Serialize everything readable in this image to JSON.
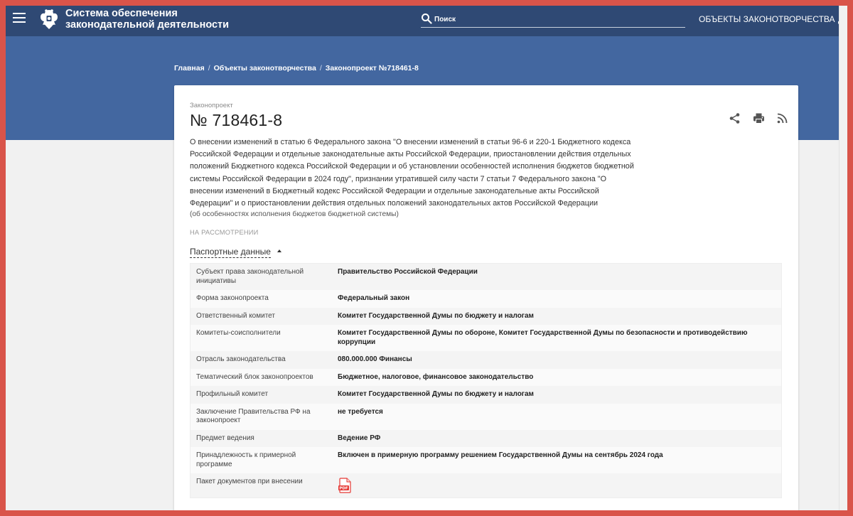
{
  "header": {
    "site_title_line1": "Система обеспечения",
    "site_title_line2": "законодательной деятельности",
    "search_placeholder": "Поиск",
    "nav_items": [
      "ОБЪЕКТЫ ЗАКОНОТВОРЧЕСТВА",
      "ДО"
    ]
  },
  "breadcrumb": {
    "items": [
      "Главная",
      "Объекты законотворчества",
      "Законопроект №718461-8"
    ]
  },
  "bill": {
    "kind": "Законопроект",
    "number": "№ 718461-8",
    "description_lines": [
      "О внесении изменений в статью 6 Федерального закона \"О внесении изменений в статьи 96-6 и 220-1 Бюджетного кодекса",
      "Российской Федерации и отдельные законодательные акты Российской Федерации, приостановлении действия отдельных",
      "положений Бюджетного кодекса Российской Федерации и об установлении особенностей исполнения бюджетов бюджетной",
      "системы Российской Федерации в 2024 году\", признании утратившей силу части 7 статьи 7 Федерального закона \"О",
      "внесении изменений в Бюджетный кодекс Российской Федерации и отдельные законодательные акты Российской",
      "Федерации\" и о приостановлении действия отдельных положений законодательных актов Российской Федерации"
    ],
    "subnote": "(об особенностях исполнения бюджетов бюджетной системы)",
    "status": "НА РАССМОТРЕНИИ",
    "actions": [
      "share-icon",
      "print-icon",
      "rss-icon"
    ]
  },
  "passport": {
    "toggle_label": "Паспортные данные",
    "rows": [
      {
        "label": "Субъект права законодательной инициативы",
        "value": "Правительство Российской Федерации"
      },
      {
        "label": "Форма законопроекта",
        "value": "Федеральный закон"
      },
      {
        "label": "Ответственный комитет",
        "value": "Комитет Государственной Думы по бюджету и налогам"
      },
      {
        "label": "Комитеты-соисполнители",
        "value": "Комитет Государственной Думы по обороне, Комитет Государственной Думы по безопасности и противодействию коррупции"
      },
      {
        "label": "Отрасль законодательства",
        "value": "080.000.000 Финансы"
      },
      {
        "label": "Тематический блок законопроектов",
        "value": "Бюджетное, налоговое, финансовое законодательство"
      },
      {
        "label": "Профильный комитет",
        "value": "Комитет Государственной Думы по бюджету и налогам"
      },
      {
        "label": "Заключение Правительства РФ на законопроект",
        "value": "не требуется"
      },
      {
        "label": "Предмет ведения",
        "value": "Ведение РФ"
      },
      {
        "label": "Принадлежность к примерной программе",
        "value": "Включен в примерную программу решением Государственной Думы на сентябрь 2024 года"
      },
      {
        "label": "Пакет документов при внесении",
        "value": ""
      }
    ],
    "pdf_icon": "pdf-icon"
  },
  "colors": {
    "navbar": "#2f4974",
    "hero": "#4367a0",
    "frame": "#d9544a",
    "pdf": "#e53935"
  }
}
